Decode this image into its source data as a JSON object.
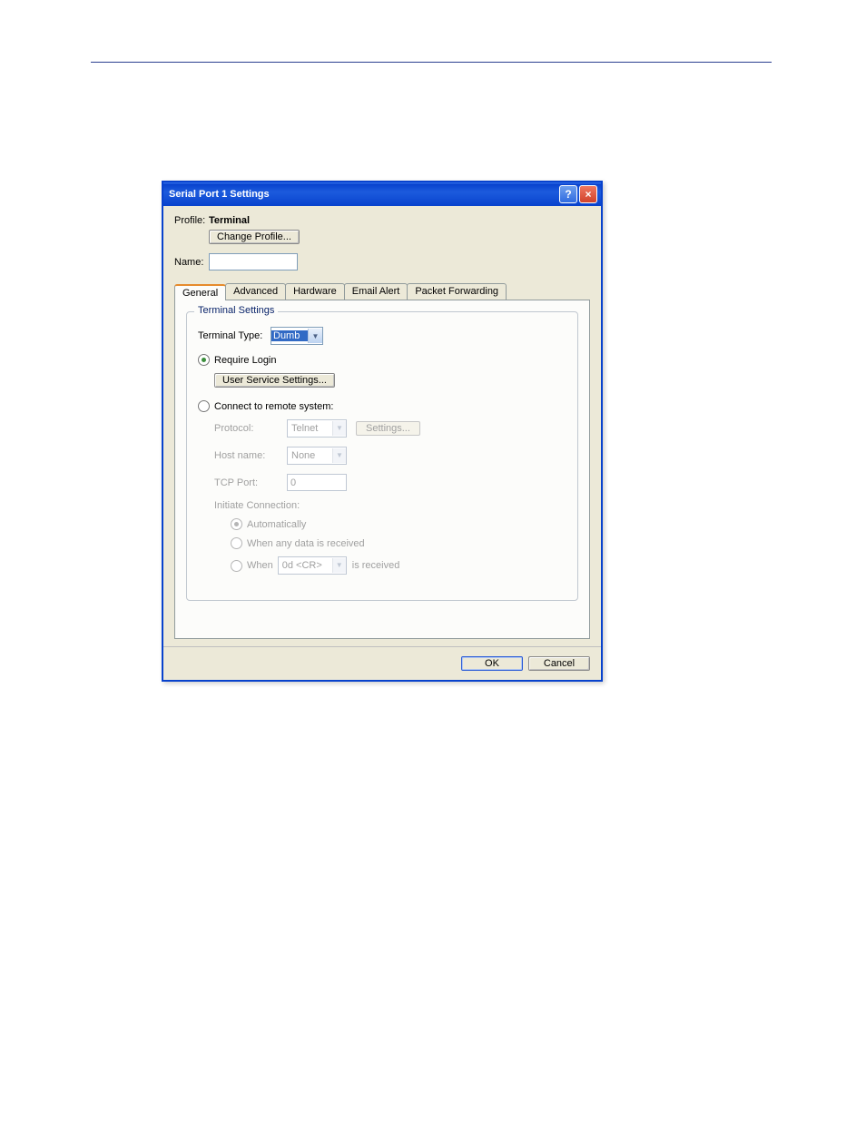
{
  "titlebar": {
    "title": "Serial Port 1 Settings"
  },
  "profile": {
    "label": "Profile:",
    "value": "Terminal",
    "change_button": "Change Profile..."
  },
  "name": {
    "label": "Name:",
    "value": ""
  },
  "tabs": {
    "general": "General",
    "advanced": "Advanced",
    "hardware": "Hardware",
    "email_alert": "Email Alert",
    "packet_forwarding": "Packet Forwarding"
  },
  "group": {
    "title": "Terminal Settings",
    "terminal_type_label": "Terminal Type:",
    "terminal_type_value": "Dumb",
    "require_login": "Require Login",
    "user_service_button": "User Service Settings...",
    "connect_remote": "Connect to remote system:",
    "protocol_label": "Protocol:",
    "protocol_value": "Telnet",
    "settings_button": "Settings...",
    "hostname_label": "Host name:",
    "hostname_value": "None",
    "tcpport_label": "TCP Port:",
    "tcpport_value": "0",
    "initiate_label": "Initiate Connection:",
    "auto": "Automatically",
    "when_any": "When any data is received",
    "when_word": "When",
    "when_value": "0d <CR>",
    "is_received": "is received"
  },
  "footer": {
    "ok": "OK",
    "cancel": "Cancel"
  }
}
